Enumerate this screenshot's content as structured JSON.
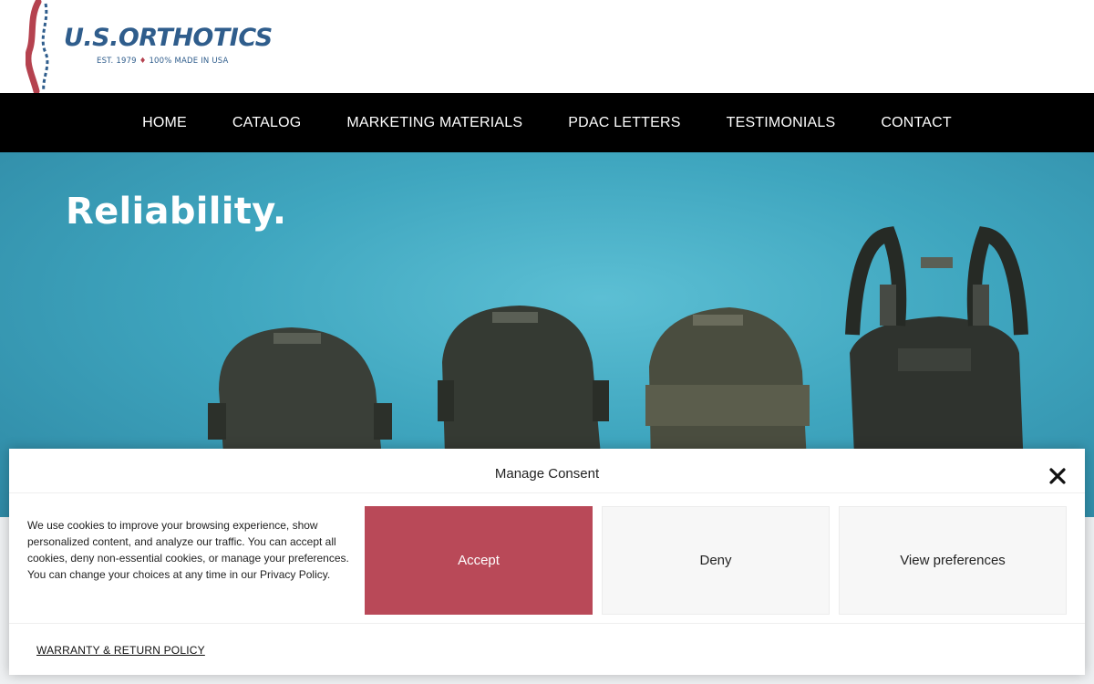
{
  "brand": {
    "name": "U.S.ORTHOTICS",
    "tagline_est": "EST. 1979",
    "tagline_made": "100% MADE IN USA",
    "colors": {
      "blue": "#2f5d8c",
      "red": "#b5424f"
    },
    "logo_icon": "spine-logo-icon"
  },
  "nav": {
    "items": [
      {
        "label": "HOME"
      },
      {
        "label": "CATALOG"
      },
      {
        "label": "MARKETING MATERIALS"
      },
      {
        "label": "PDAC LETTERS"
      },
      {
        "label": "TESTIMONIALS"
      },
      {
        "label": "CONTACT"
      }
    ]
  },
  "hero": {
    "title": "Reliability.",
    "background_color": "#3fa6bf",
    "image": "orthotic-braces-photo"
  },
  "consent": {
    "title": "Manage Consent",
    "close_icon": "close-icon",
    "text": "We use cookies to improve your browsing experience, show personalized content, and analyze our traffic. You can accept all cookies, deny non-essential cookies, or manage your preferences. You can change your choices at any time in our Privacy Policy.",
    "accept_label": "Accept",
    "deny_label": "Deny",
    "preferences_label": "View preferences",
    "policy_link": "WARRANTY & RETURN POLICY",
    "accent_color": "#b94958"
  }
}
